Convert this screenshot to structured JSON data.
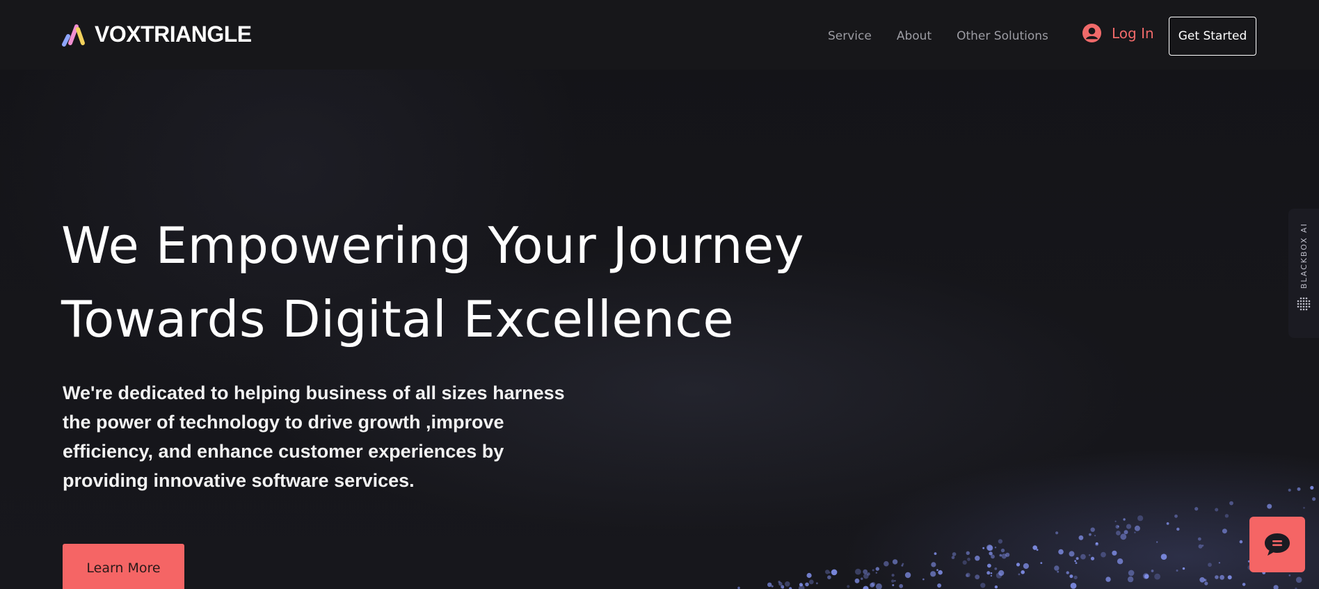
{
  "brand": {
    "name": "VOXTRIANGLE"
  },
  "nav": {
    "items": [
      "Service",
      "About",
      "Other Solutions"
    ],
    "login_label": "Log In",
    "get_started_label": "Get Started"
  },
  "hero": {
    "title_line1": "We Empowering Your Journey",
    "title_line2": "Towards Digital Excellence",
    "description": "We're dedicated to helping business of all sizes harness the power of technology to drive growth ,improve efficiency, and enhance customer experiences by providing innovative software services.",
    "cta_label": "Learn More"
  },
  "side_widget": {
    "label": "BLACKBOX AI"
  },
  "colors": {
    "accent": "#f56565",
    "background": "#16161a",
    "nav_text": "#9c9ca3",
    "logo_stripes": [
      "#8fa6ff",
      "#f08fd0",
      "#f2d15c"
    ]
  },
  "icons": {
    "logo": "triple-stripe-logo-icon",
    "user": "user-circle-icon",
    "chat": "chat-bubble-icon",
    "side": "dot-grid-icon"
  }
}
